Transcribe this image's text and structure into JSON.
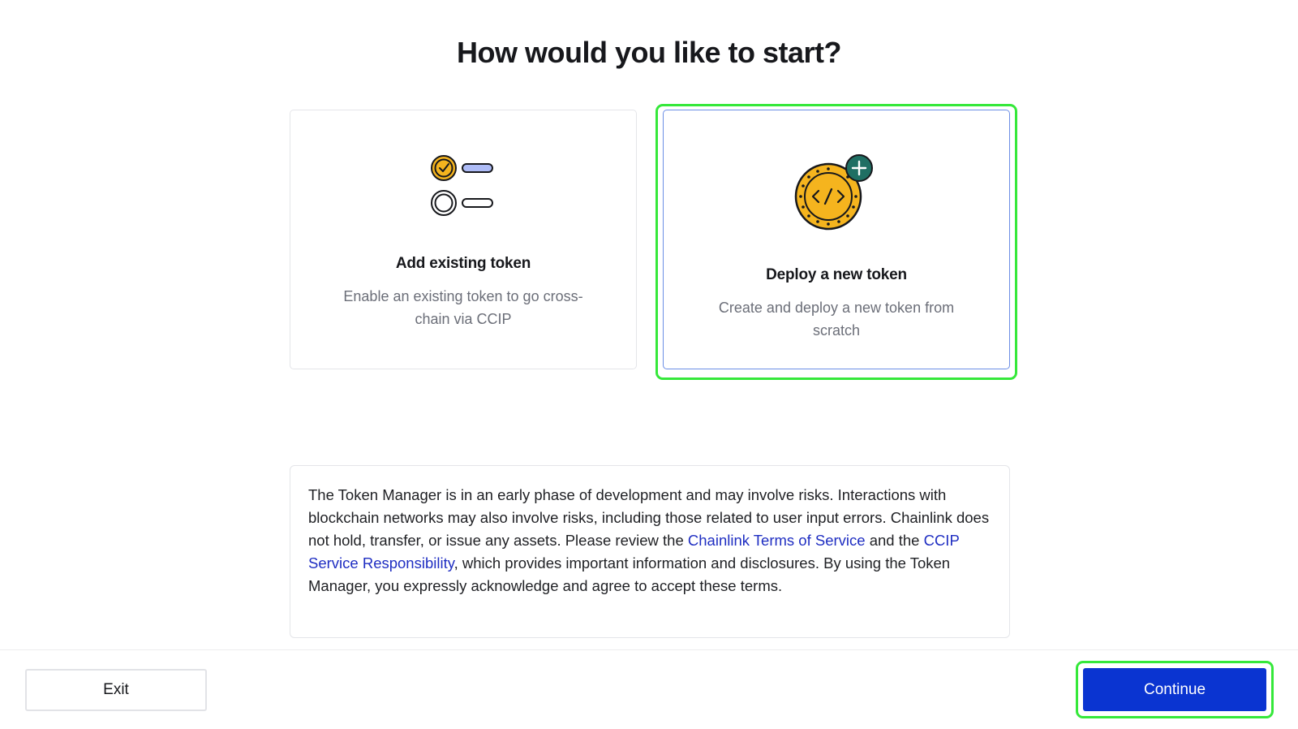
{
  "heading": "How would you like to start?",
  "options": [
    {
      "title": "Add existing token",
      "description": "Enable an existing token to go cross-chain via CCIP",
      "icon": "checklist-icon",
      "selected": false
    },
    {
      "title": "Deploy a new token",
      "description": "Create and deploy a new token from scratch",
      "icon": "code-coin-plus-icon",
      "selected": true
    }
  ],
  "notice": {
    "text_before_link1": "The Token Manager is in an early phase of development and may involve risks. Interactions with blockchain networks may also involve risks, including those related to user input errors. Chainlink does not hold, transfer, or issue any assets. Please review the ",
    "link1": "Chainlink Terms of Service",
    "text_between": " and the ",
    "link2": "CCIP Service Responsibility",
    "text_after": ", which provides important information and disclosures. By using the Token Manager, you expressly acknowledge and agree to accept these terms."
  },
  "footer": {
    "exit_label": "Exit",
    "continue_label": "Continue"
  },
  "colors": {
    "primary": "#0a34d1",
    "link": "#1f2ec2",
    "highlight": "#35e83a",
    "coin": "#f5b41e",
    "plus_badge": "#1f6f63"
  }
}
